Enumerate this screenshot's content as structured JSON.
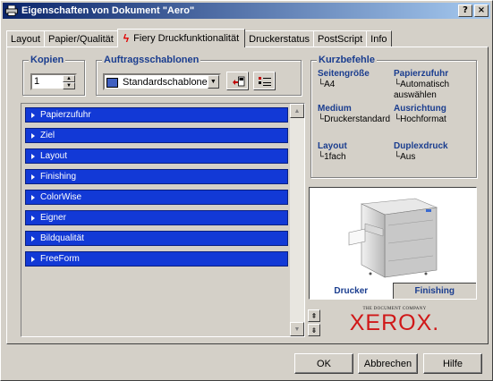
{
  "window": {
    "title": "Eigenschaften von Dokument \"Aero\""
  },
  "titlebar_buttons": {
    "help": "?",
    "close": "×"
  },
  "tabs": [
    {
      "label": "Layout"
    },
    {
      "label": "Papier/Qualität"
    },
    {
      "label": "Fiery Druckfunktionalität",
      "active": true
    },
    {
      "label": "Druckerstatus"
    },
    {
      "label": "PostScript"
    },
    {
      "label": "Info"
    }
  ],
  "copies": {
    "label": "Kopien",
    "value": "1"
  },
  "templates": {
    "label": "Auftragsschablonen",
    "value": "Standardschablone"
  },
  "feature_rows": [
    {
      "label": "Papierzufuhr"
    },
    {
      "label": "Ziel"
    },
    {
      "label": "Layout"
    },
    {
      "label": "Finishing"
    },
    {
      "label": "ColorWise"
    },
    {
      "label": "Eigner"
    },
    {
      "label": "Bildqualität"
    },
    {
      "label": "FreeForm"
    }
  ],
  "shortcuts": {
    "title": "Kurzbefehle",
    "items": [
      {
        "key": "Seitengröße",
        "value": "A4"
      },
      {
        "key": "Papierzufuhr",
        "value": "Automatisch auswählen"
      },
      {
        "key": "Medium",
        "value": "Druckerstandard"
      },
      {
        "key": "Ausrichtung",
        "value": "Hochformat"
      },
      {
        "key": "Layout",
        "value": "1fach"
      },
      {
        "key": "Duplexdruck",
        "value": "Aus"
      }
    ]
  },
  "preview": {
    "tab_printer": "Drucker",
    "tab_finishing": "Finishing"
  },
  "brand": {
    "tagline": "THE DOCUMENT COMPANY",
    "name": "XEROX."
  },
  "buttons": {
    "ok": "OK",
    "cancel": "Abbrechen",
    "help": "Hilfe"
  },
  "colors": {
    "accent_blue": "#1239d6",
    "label_blue": "#1a3d8f",
    "xerox_red": "#d01818"
  }
}
